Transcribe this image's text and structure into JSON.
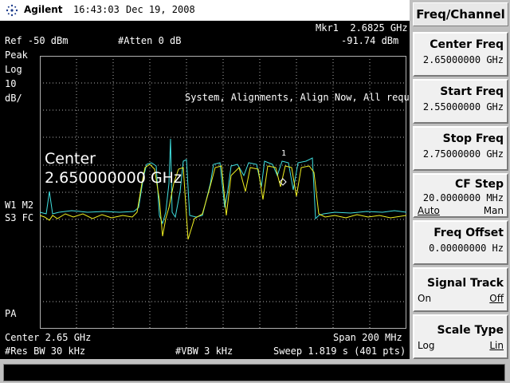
{
  "header": {
    "brand": "Agilent",
    "time": "16:43:03",
    "date": "Dec 19, 2008"
  },
  "display": {
    "marker_label": "Mkr1  2.6825 GHz",
    "marker_value": "-91.74 dBm",
    "ref_level": "Ref -50 dBm",
    "atten": "#Atten 0 dB",
    "detector": "Peak",
    "scale_type": "Log",
    "scale_div": "10",
    "scale_unit": "dB/",
    "message": "System, Alignments, Align Now, All required",
    "center_overlay_label": "Center",
    "center_overlay_value": "2.650000000 GHz",
    "marker_number": "1",
    "trace_info_1": "W1 M2",
    "trace_info_2": "S3 FC",
    "pa": "PA",
    "center": "Center 2.65 GHz",
    "span": "Span 200 MHz",
    "res_bw": "#Res BW 30 kHz",
    "vbw": "#VBW 3 kHz",
    "sweep": "Sweep 1.819 s (401 pts)"
  },
  "menu": {
    "title": "Freq/Channel",
    "keys": [
      {
        "label": "Center Freq",
        "value": "2.65000000 GHz"
      },
      {
        "label": "Start Freq",
        "value": "2.55000000 GHz"
      },
      {
        "label": "Stop Freq",
        "value": "2.75000000 GHz"
      },
      {
        "label": "CF Step",
        "value": "20.0000000 MHz",
        "opt_left": "Auto",
        "opt_right": "Man"
      },
      {
        "label": "Freq Offset",
        "value": "0.00000000  Hz"
      },
      {
        "label": "Signal Track",
        "opt_left": "On",
        "opt_right": "Off"
      },
      {
        "label": "Scale Type",
        "opt_left": "Log",
        "opt_right": "Lin"
      }
    ]
  },
  "colors": {
    "trace_yellow": "#f0f020",
    "trace_cyan": "#40e0e0",
    "grid": "#b0b0b0",
    "background": "#000000"
  }
}
